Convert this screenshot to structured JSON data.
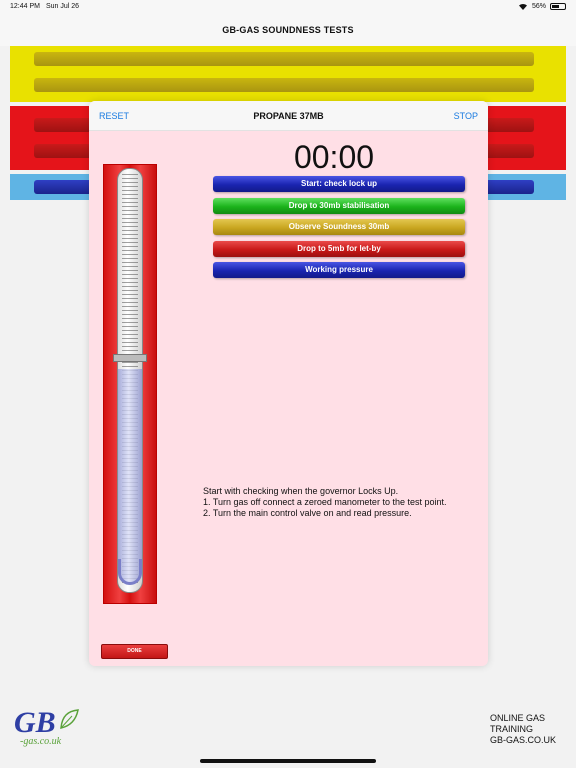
{
  "status_bar": {
    "time": "12:44 PM",
    "date": "Sun Jul 26",
    "battery": "56%",
    "battery_level": 0.56
  },
  "app": {
    "title": "GB-GAS SOUNDNESS TESTS"
  },
  "modal": {
    "reset_label": "RESET",
    "title": "PROPANE 37MB",
    "stop_label": "STOP",
    "timer": "00:00",
    "steps": [
      {
        "label": "Start: check lock up",
        "color": "#1a24b0"
      },
      {
        "label": "Drop to 30mb stabilisation",
        "color": "#1bb31b"
      },
      {
        "label": "Observe Soundness 30mb",
        "color": "#c9a620"
      },
      {
        "label": "Drop to 5mb for let-by",
        "color": "#c81818"
      },
      {
        "label": "Working pressure",
        "color": "#1a24b0"
      }
    ],
    "instructions": [
      "Start with checking when the governor Locks Up.",
      "1. Turn gas off connect a zeroed manometer to the test point.",
      "2. Turn the main control valve on and read pressure."
    ],
    "done_label": "DONE"
  },
  "logo": {
    "main": "GB",
    "sub": "-gas.co.uk",
    "icon": "leaf-icon"
  },
  "footer": {
    "lines": [
      "ONLINE GAS",
      "TRAINING",
      "GB-GAS.CO.UK"
    ]
  },
  "colors": {
    "accent": "#1a7be0",
    "modal_bg": "#ffdfe6",
    "band_yellow": "#e9e100",
    "band_red": "#e5141a",
    "band_blue": "#5fb4e4"
  }
}
